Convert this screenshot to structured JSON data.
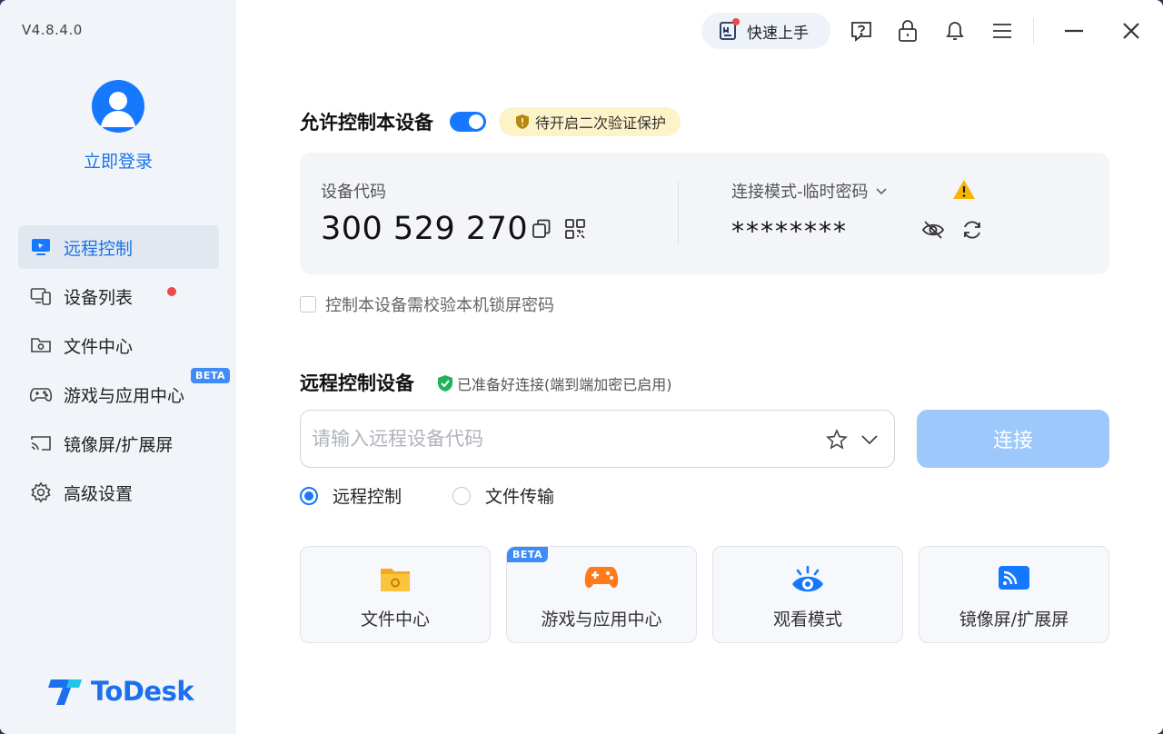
{
  "app": {
    "version": "V4.8.4.0",
    "brand_name": "ToDesk"
  },
  "sidebar": {
    "login_label": "立即登录",
    "items": [
      {
        "label": "远程控制",
        "icon": "monitor-remote-icon",
        "active": true
      },
      {
        "label": "设备列表",
        "icon": "device-list-icon",
        "badge": "red-dot"
      },
      {
        "label": "文件中心",
        "icon": "folder-gear-icon"
      },
      {
        "label": "游戏与应用中心",
        "icon": "gamepad-icon",
        "badge": "BETA"
      },
      {
        "label": "镜像屏/扩展屏",
        "icon": "cast-screen-icon"
      },
      {
        "label": "高级设置",
        "icon": "gear-icon"
      }
    ]
  },
  "topbar": {
    "quickstart_label": "快速上手",
    "icons": [
      "help-icon",
      "lock-icon",
      "bell-icon",
      "menu-icon",
      "minimize-icon",
      "close-icon"
    ]
  },
  "allow_control": {
    "title": "允许控制本设备",
    "enabled": true,
    "warning_label": "待开启二次验证保护"
  },
  "device": {
    "code_label": "设备代码",
    "code": "300 529 270",
    "mode_label": "连接模式-临时密码",
    "password": "********"
  },
  "lock_screen_check": {
    "label": "控制本设备需校验本机锁屏密码",
    "checked": false
  },
  "remote": {
    "title": "远程控制设备",
    "status": "已准备好连接(端到端加密已启用)",
    "input_placeholder": "请输入远程设备代码",
    "input_value": "",
    "connect_label": "连接",
    "modes": [
      {
        "label": "远程控制",
        "checked": true
      },
      {
        "label": "文件传输",
        "checked": false
      }
    ]
  },
  "tiles": [
    {
      "label": "文件中心",
      "icon": "folder-icon"
    },
    {
      "label": "游戏与应用中心",
      "icon": "gamepad-icon",
      "badge": "BETA"
    },
    {
      "label": "观看模式",
      "icon": "eye-icon"
    },
    {
      "label": "镜像屏/扩展屏",
      "icon": "cast-icon"
    }
  ],
  "colors": {
    "accent": "#1677ff",
    "connect_disabled": "#9cc8fb",
    "warning_bg": "#fdf3c8",
    "success": "#21b35a",
    "tile_orange": "#ff7a1a"
  }
}
